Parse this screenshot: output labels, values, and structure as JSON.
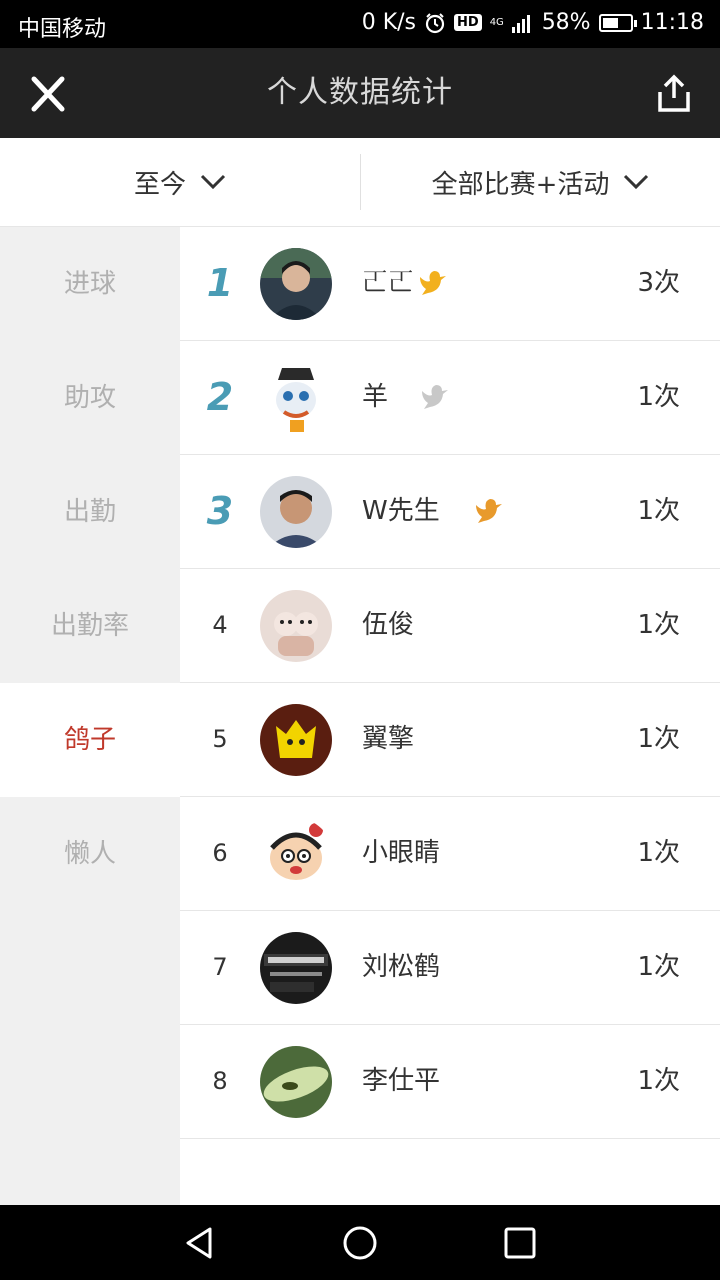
{
  "status_bar": {
    "carrier": "中国移动",
    "speed": "0 K/s",
    "hd": "HD",
    "network": "4G",
    "battery_percent": "58%",
    "battery_level": 0.58,
    "time": "11:18",
    "icons": [
      "alarm-icon",
      "signal-icon",
      "battery-icon"
    ]
  },
  "header": {
    "title": "个人数据统计",
    "close_icon": "close-icon",
    "share_icon": "share-icon",
    "background": "#222222"
  },
  "filters": {
    "period": "至今",
    "scope": "全部比赛+活动"
  },
  "sidebar": {
    "items": [
      {
        "label": "进球",
        "active": false
      },
      {
        "label": "助攻",
        "active": false
      },
      {
        "label": "出勤",
        "active": false
      },
      {
        "label": "出勤率",
        "active": false
      },
      {
        "label": "鸽子",
        "active": true
      },
      {
        "label": "懒人",
        "active": false
      }
    ],
    "active_color": "#c0392b"
  },
  "ranking": {
    "rows": [
      {
        "rank": "1",
        "name": "𠀀𠀀",
        "count": "3次",
        "bird": "gold"
      },
      {
        "rank": "2",
        "name": "羊",
        "count": "1次",
        "bird": "silver"
      },
      {
        "rank": "3",
        "name": "W先生",
        "count": "1次",
        "bird": "bronze"
      },
      {
        "rank": "4",
        "name": "伍俊",
        "count": "1次",
        "bird": ""
      },
      {
        "rank": "5",
        "name": "翼擎",
        "count": "1次",
        "bird": ""
      },
      {
        "rank": "6",
        "name": "小眼睛",
        "count": "1次",
        "bird": ""
      },
      {
        "rank": "7",
        "name": "刘松鹤",
        "count": "1次",
        "bird": ""
      },
      {
        "rank": "8",
        "name": "李仕平",
        "count": "1次",
        "bird": ""
      }
    ],
    "top_rank_color": "#4a9cb5",
    "bird_colors": {
      "gold": "#f2b01e",
      "silver": "#c8c8c8",
      "bronze": "#e89a2c"
    }
  },
  "nav_bar": {
    "icons": [
      "back-icon",
      "home-icon",
      "recents-icon"
    ]
  }
}
